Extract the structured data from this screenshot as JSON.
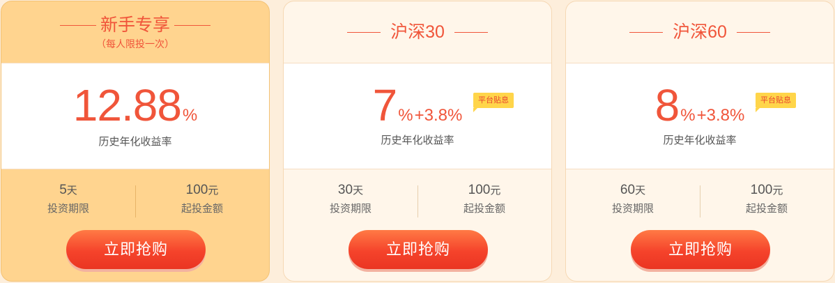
{
  "colors": {
    "accent": "#f0553a",
    "badge_bg": "#ffd54a",
    "featured_card_bg": "#ffd48f",
    "card_bg": "#fff6ea",
    "button": "#f5432b"
  },
  "cards": [
    {
      "title": "新手专享",
      "subtitle": "（每人限投一次）",
      "rate_main": "12.88",
      "rate_pct": "%",
      "rate_bonus": "",
      "badge": "",
      "rate_label": "历史年化收益率",
      "term_value": "5",
      "term_unit": "天",
      "term_label": "投资期限",
      "min_value": "100",
      "min_unit": "元",
      "min_label": "起投金额",
      "button": "立即抢购"
    },
    {
      "title": "沪深30",
      "subtitle": "",
      "rate_main": "7",
      "rate_pct": "%",
      "rate_bonus": "+3.8%",
      "badge": "平台贴息",
      "rate_label": "历史年化收益率",
      "term_value": "30",
      "term_unit": "天",
      "term_label": "投资期限",
      "min_value": "100",
      "min_unit": "元",
      "min_label": "起投金额",
      "button": "立即抢购"
    },
    {
      "title": "沪深60",
      "subtitle": "",
      "rate_main": "8",
      "rate_pct": "%",
      "rate_bonus": "+3.8%",
      "badge": "平台贴息",
      "rate_label": "历史年化收益率",
      "term_value": "60",
      "term_unit": "天",
      "term_label": "投资期限",
      "min_value": "100",
      "min_unit": "元",
      "min_label": "起投金额",
      "button": "立即抢购"
    }
  ]
}
